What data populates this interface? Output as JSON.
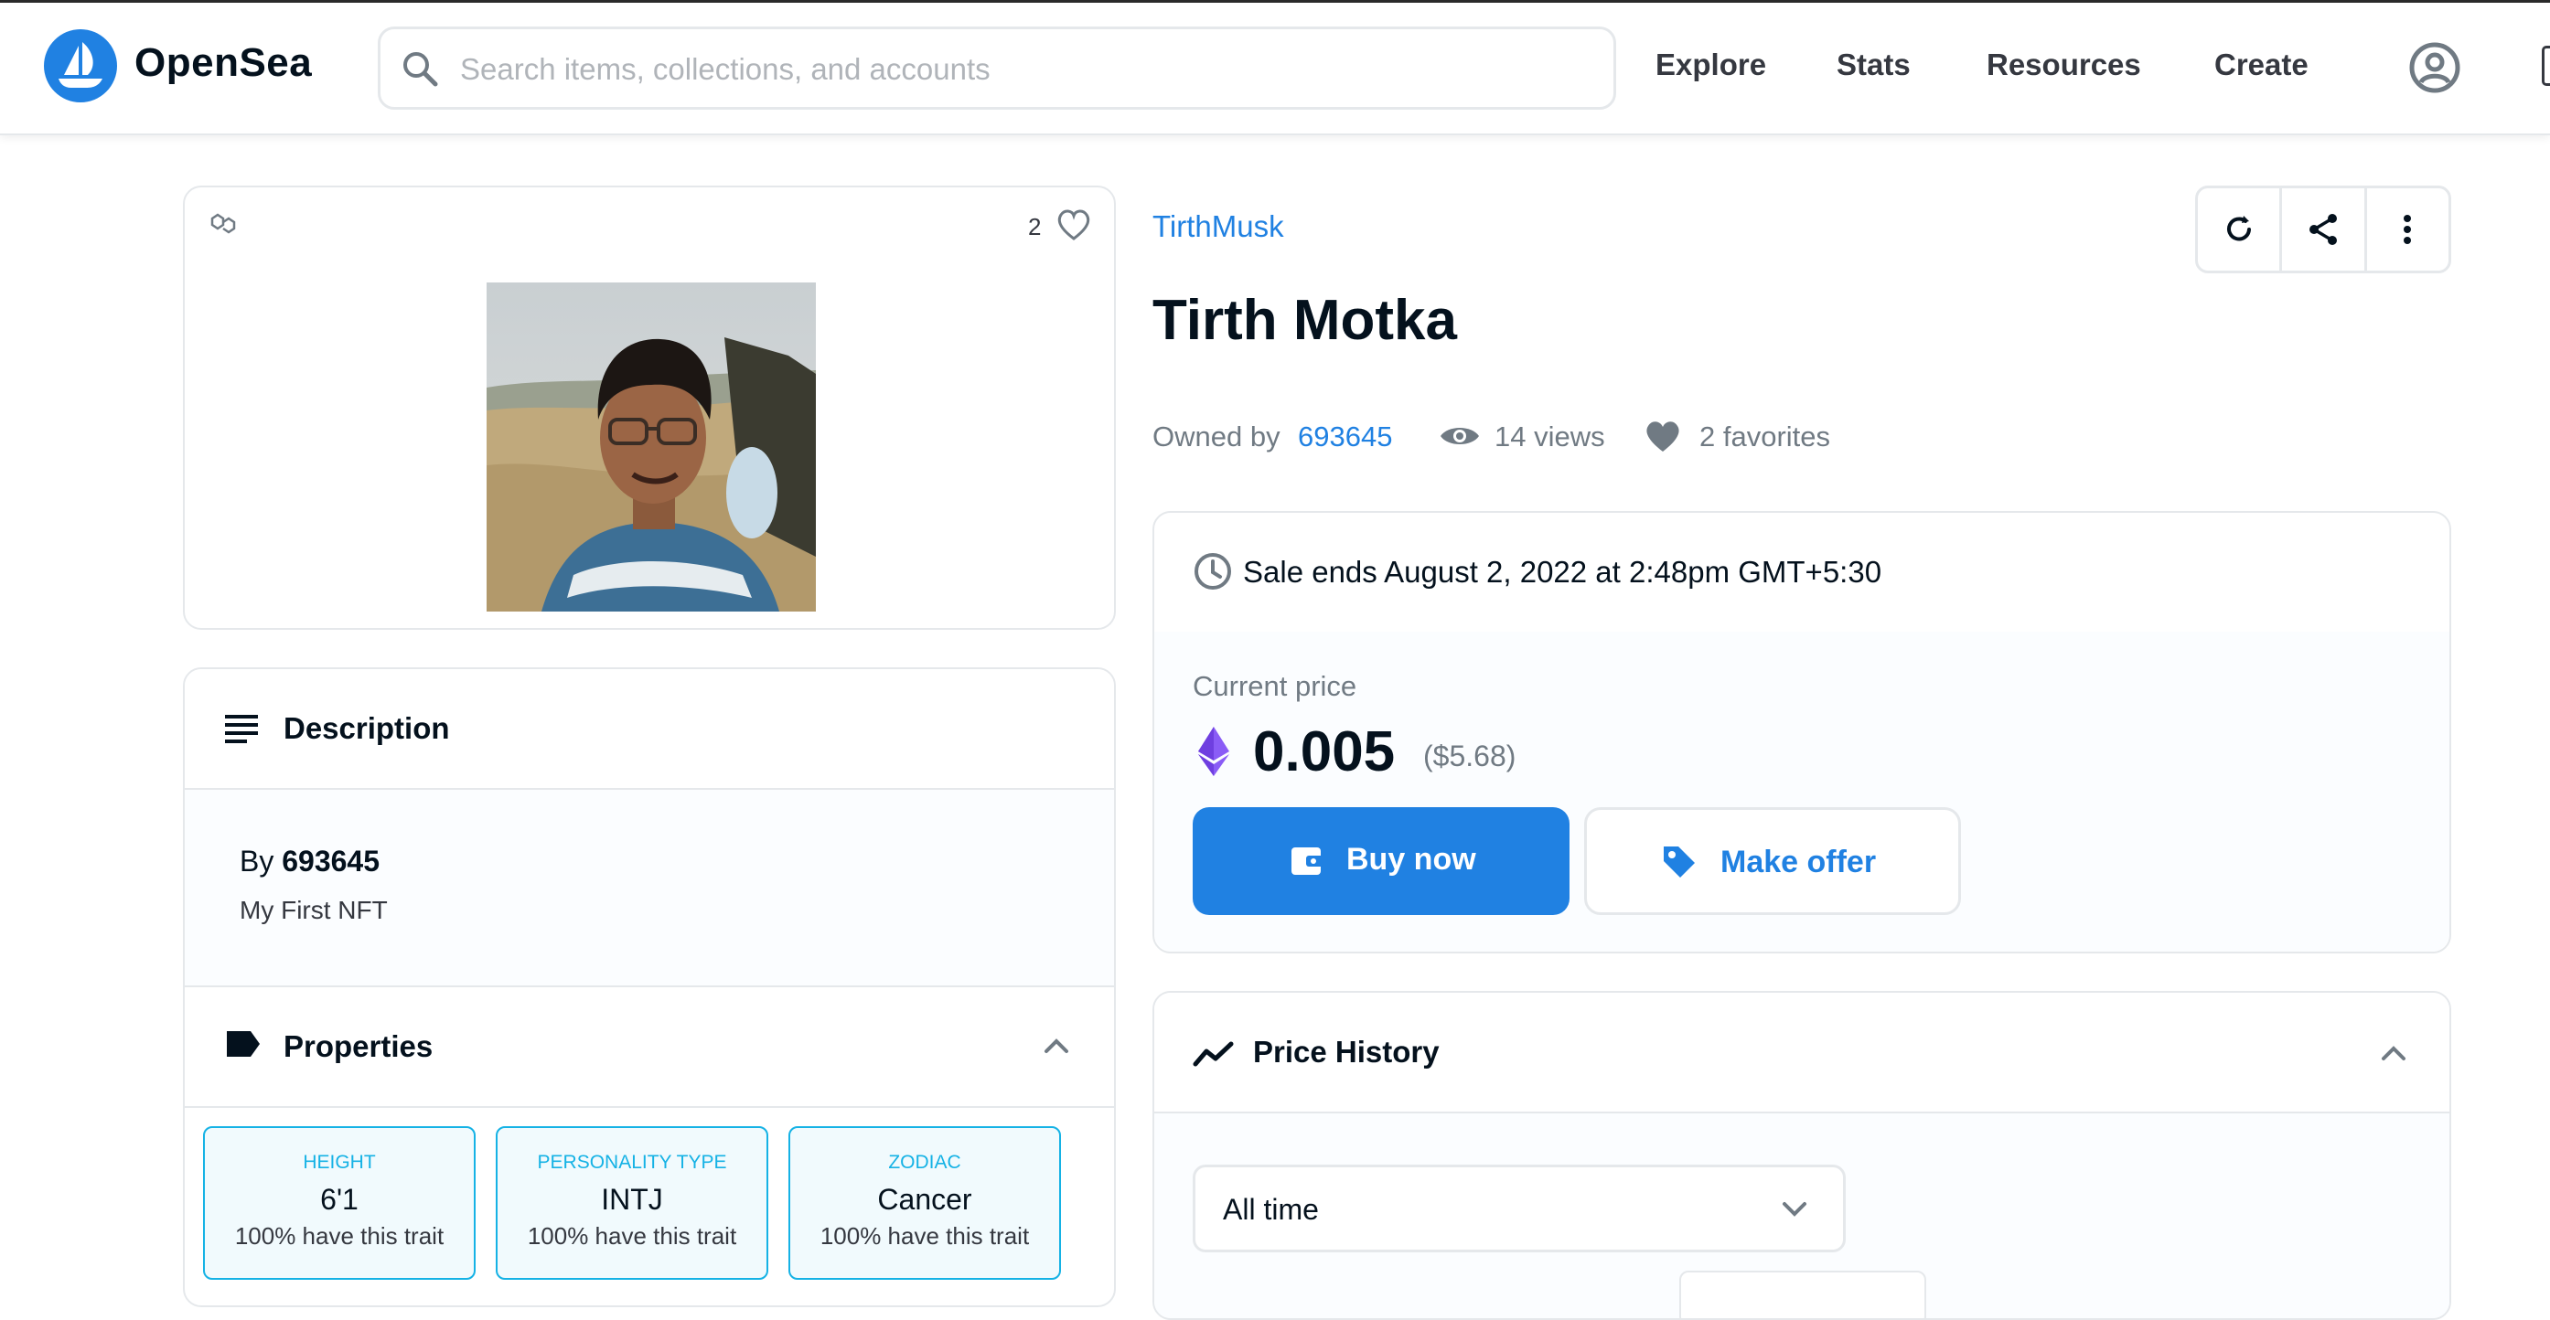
{
  "nav": {
    "brand": "OpenSea",
    "search_placeholder": "Search items, collections, and accounts",
    "links": [
      "Explore",
      "Stats",
      "Resources",
      "Create"
    ]
  },
  "asset": {
    "like_count": "2",
    "collection": "TirthMusk",
    "name": "Tirth Motka",
    "owned_by_label": "Owned by",
    "owner": "693645",
    "views": "14 views",
    "favorites": "2 favorites"
  },
  "description": {
    "header": "Description",
    "by_label": "By",
    "creator": "693645",
    "text": "My First NFT"
  },
  "properties": {
    "header": "Properties",
    "items": [
      {
        "type": "HEIGHT",
        "value": "6'1",
        "rarity": "100% have this trait"
      },
      {
        "type": "PERSONALITY TYPE",
        "value": "INTJ",
        "rarity": "100% have this trait"
      },
      {
        "type": "ZODIAC",
        "value": "Cancer",
        "rarity": "100% have this trait"
      }
    ]
  },
  "sale": {
    "ends_text": "Sale ends August 2, 2022 at 2:48pm GMT+5:30",
    "current_price_label": "Current price",
    "price": "0.005",
    "price_usd": "($5.68)",
    "buy_label": "Buy now",
    "offer_label": "Make offer"
  },
  "price_history": {
    "header": "Price History",
    "range_selected": "All time"
  },
  "colors": {
    "accent": "#2081e2",
    "trait": "#15b2e5",
    "text_dark": "#04111d",
    "text_muted": "#707a83",
    "border": "#e5e8eb"
  },
  "icons": [
    "opensea-logo-icon",
    "search-icon",
    "profile-icon",
    "polygon-chain-icon",
    "heart-icon",
    "refresh-icon",
    "share-icon",
    "more-vertical-icon",
    "eye-icon",
    "clock-icon",
    "ethereum-icon",
    "wallet-icon",
    "tag-icon",
    "description-lines-icon",
    "label-icon",
    "chevron-up-icon",
    "trend-line-icon",
    "chevron-down-icon"
  ]
}
